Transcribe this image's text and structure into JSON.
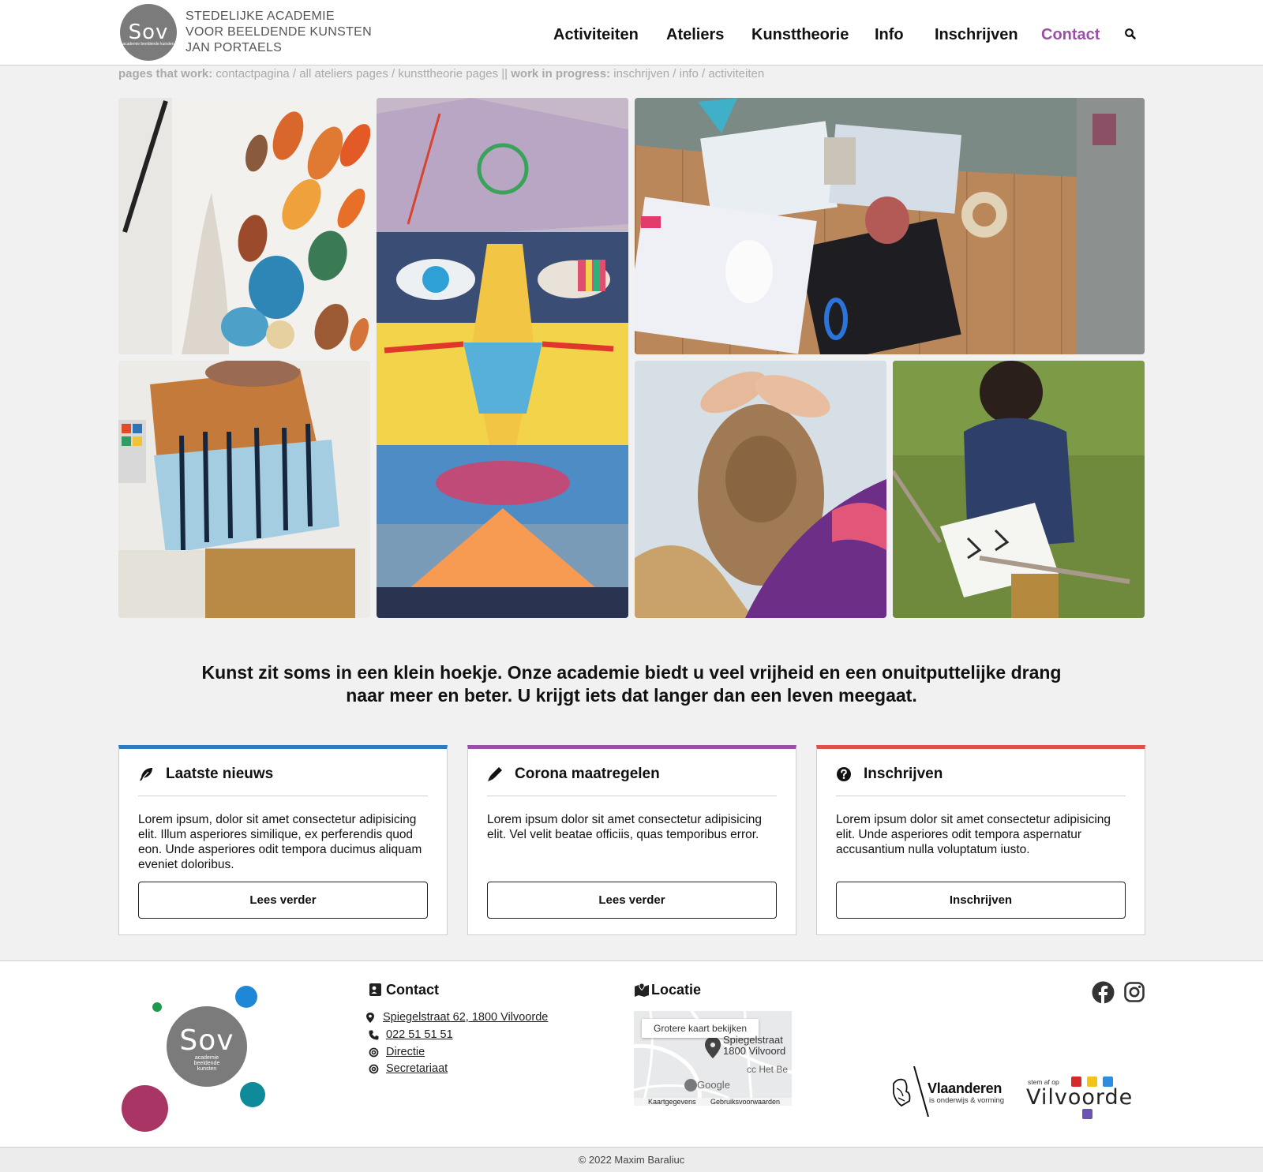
{
  "header": {
    "logo_text": "Sov",
    "logo_sub": "academie beeldende kunsten",
    "brand_lines": [
      "STEDELIJKE ACADEMIE",
      "VOOR BEELDENDE KUNSTEN",
      "JAN PORTAELS"
    ],
    "nav": [
      "Activiteiten",
      "Ateliers",
      "Kunsttheorie",
      "Info",
      "Inschrijven",
      "Contact"
    ],
    "active_nav": "Contact",
    "search_icon": "search-icon"
  },
  "status": {
    "works_label": "pages that work:",
    "works_value": "contactpagina / all ateliers pages / kunsttheorie pages ||",
    "wip_label": "work in progress:",
    "wip_value": "inschrijven / info / activiteiten"
  },
  "tagline": "Kunst zit soms in een klein hoekje. Onze academie biedt u veel vrijheid en een onuitputtelijke drang naar meer en beter. U krijgt iets dat langer dan een leven meegaat.",
  "cards": [
    {
      "title": "Laatste nieuws",
      "icon": "feather-icon",
      "accent": "#2a7bbf",
      "body": "Lorem ipsum, dolor sit amet consectetur adipisicing elit. Illum asperiores similique, ex perferendis quod eon. Unde asperiores odit tempora ducimus aliquam eveniet doloribus.",
      "button": "Lees verder"
    },
    {
      "title": "Corona maatregelen",
      "icon": "marker-icon",
      "accent": "#9b4fa8",
      "body": "Lorem ipsum dolor sit amet consectetur adipisicing elit. Vel velit beatae officiis, quas temporibus error.",
      "button": "Lees verder"
    },
    {
      "title": "Inschrijven",
      "icon": "question-circle-icon",
      "accent": "#e0504a",
      "body": "Lorem ipsum dolor sit amet consectetur adipisicing elit. Unde asperiores odit tempora aspernatur accusantium nulla voluptatum iusto.",
      "button": "Inschrijven"
    }
  ],
  "footer": {
    "logo_text": "Sov",
    "logo_sub": "academie beeldende kunsten",
    "contact_title": "Contact",
    "address": "Spiegelstraat 62, 1800 Vilvoorde",
    "phone": "022 51 51 51",
    "directie": "Directie",
    "secretariaat": "Secretariaat",
    "location_title": "Locatie",
    "map_button": "Grotere kaart bekijken",
    "map_place_line1": "Spiegelstraat",
    "map_place_line2": "1800 Vilvoord",
    "map_poi": "cc Het Be",
    "map_google": "Google",
    "map_footer_left": "Kaartgegevens",
    "map_footer_right": "Gebruiksvoorwaarden",
    "vlaanderen": "Vlaanderen",
    "vlaanderen_sub": "is onderwijs & vorming",
    "vilvoorde_small": "stem af op",
    "vilvoorde": "Vilvoorde",
    "social": [
      "facebook-icon",
      "instagram-icon"
    ]
  },
  "copyright": "© 2022 Maxim Baraliuc",
  "colors": {
    "accent_purple": "#9b4fa8",
    "accent_blue": "#2a7bbf",
    "accent_red": "#e0504a"
  }
}
